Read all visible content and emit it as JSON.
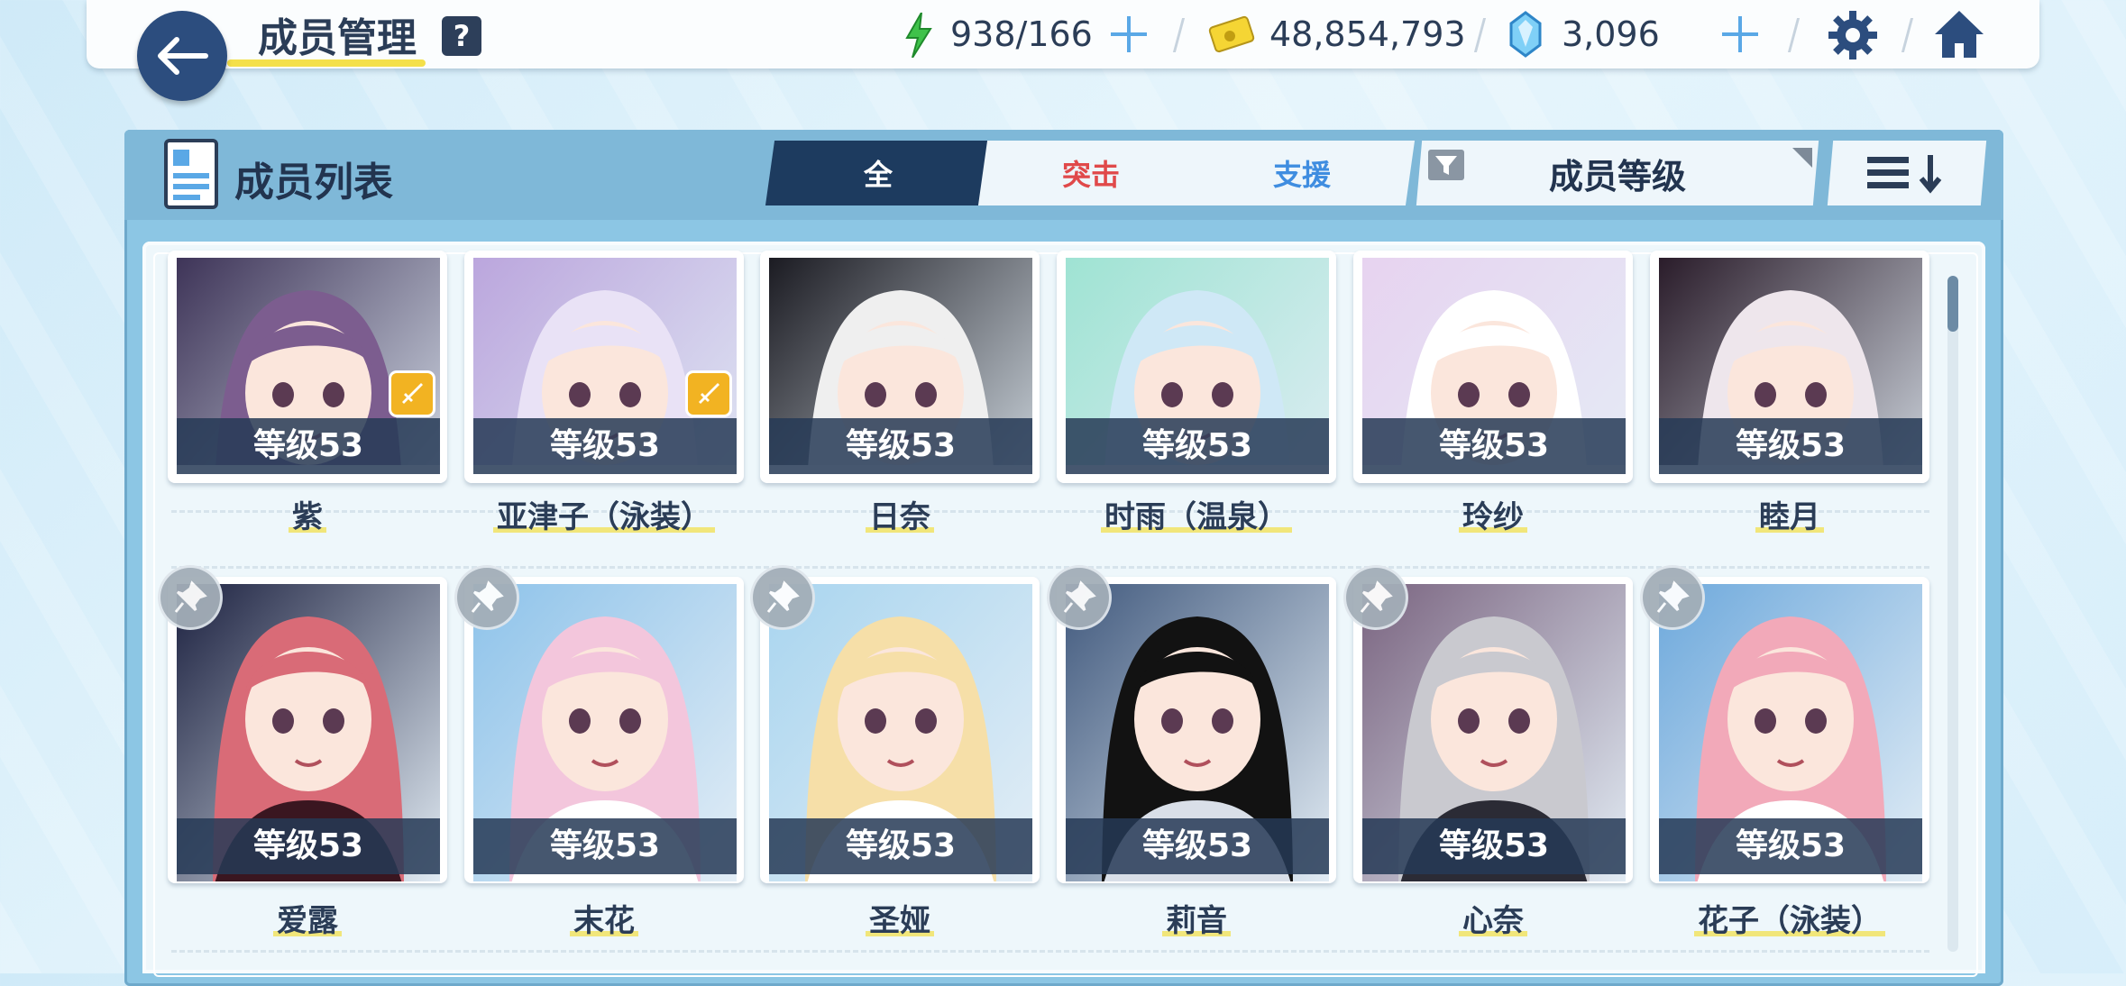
{
  "header": {
    "title": "成员管理",
    "help_label": "?",
    "ap": "938/166",
    "credits": "48,854,793",
    "pyroxene": "3,096"
  },
  "panel": {
    "title": "成员列表",
    "tabs": [
      {
        "label": "全",
        "active": true
      },
      {
        "label": "突击",
        "color": "#e0494a"
      },
      {
        "label": "支援",
        "color": "#3f8de0"
      }
    ],
    "sort_label": "成员等级"
  },
  "students_row1": [
    {
      "name": "紫",
      "level": "等级53",
      "striker": true,
      "colors": [
        "#3e3458",
        "#7c5d8f",
        "#c8b6d2"
      ]
    },
    {
      "name": "亚津子（泳装）",
      "level": "等级53",
      "striker": true,
      "colors": [
        "#bba6dd",
        "#e9e2f6",
        "#7fb8e6"
      ]
    },
    {
      "name": "日奈",
      "level": "等级53",
      "striker": false,
      "colors": [
        "#1b1b22",
        "#efefef",
        "#6a2f3a"
      ]
    },
    {
      "name": "时雨（温泉）",
      "level": "等级53",
      "striker": false,
      "colors": [
        "#9fe3d3",
        "#cfe8f6",
        "#3a5a8c"
      ]
    },
    {
      "name": "玲纱",
      "level": "等级53",
      "striker": false,
      "colors": [
        "#e7d3f0",
        "#ffffff",
        "#283c66"
      ]
    },
    {
      "name": "睦月",
      "level": "等级53",
      "striker": false,
      "colors": [
        "#2a1c2a",
        "#eee6ec",
        "#8b2a35"
      ]
    }
  ],
  "students_row2": [
    {
      "name": "爱露",
      "level": "等级53",
      "colors": [
        "#1c2140",
        "#d96b77",
        "#3a1620"
      ]
    },
    {
      "name": "末花",
      "level": "等级53",
      "colors": [
        "#8ec3ea",
        "#f3c6dc",
        "#ffffff"
      ]
    },
    {
      "name": "圣娅",
      "level": "等级53",
      "colors": [
        "#a9d5ef",
        "#f6dfa8",
        "#ffffff"
      ]
    },
    {
      "name": "莉音",
      "level": "等级53",
      "colors": [
        "#425a7e",
        "#121212",
        "#d9dfe8"
      ]
    },
    {
      "name": "心奈",
      "level": "等级53",
      "colors": [
        "#7a6480",
        "#c9c9cf",
        "#2b2b35"
      ]
    },
    {
      "name": "花子（泳装）",
      "level": "等级53",
      "colors": [
        "#6ea9dc",
        "#f2a9b9",
        "#ffffff"
      ]
    }
  ]
}
